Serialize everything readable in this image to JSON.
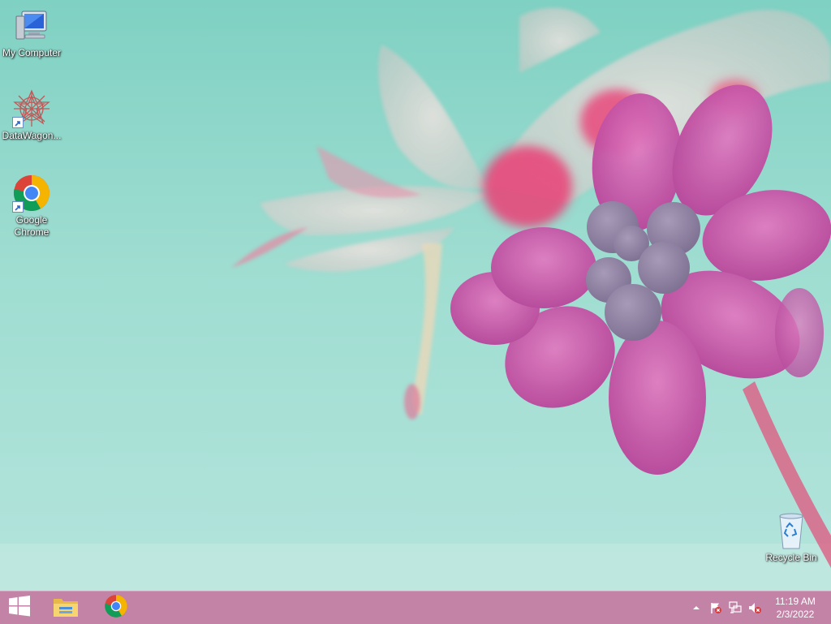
{
  "desktop": {
    "icons": [
      {
        "label": "My Computer",
        "icon": "computer-icon"
      },
      {
        "label": "DataWagon...",
        "icon": "datawagon-icon"
      },
      {
        "label": "Google Chrome",
        "icon": "chrome-icon"
      },
      {
        "label": "Recycle Bin",
        "icon": "recycle-bin-icon"
      }
    ]
  },
  "taskbar": {
    "start_icon": "windows-start-icon",
    "pinned": [
      {
        "icon": "file-explorer-icon"
      },
      {
        "icon": "chrome-icon"
      }
    ],
    "tray": {
      "icons": [
        "show-hidden-icons-chevron",
        "action-center-flag-icon",
        "network-icon",
        "volume-muted-icon"
      ],
      "time": "11:19 AM",
      "date": "2/3/2022"
    }
  },
  "colors": {
    "wallpaper_base": "#8fd6c9",
    "flower_pink": "#c94ea0",
    "taskbar": "#be78a0"
  }
}
